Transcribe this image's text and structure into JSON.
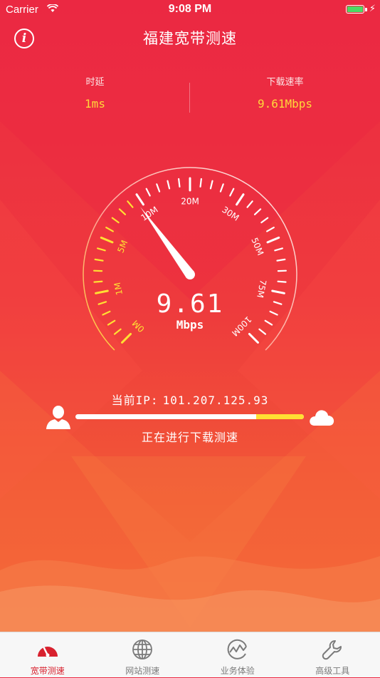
{
  "status_bar": {
    "carrier": "Carrier",
    "time": "9:08 PM"
  },
  "nav": {
    "title": "福建宽带测速"
  },
  "stats": {
    "latency": {
      "label": "时延",
      "value": "1ms"
    },
    "download": {
      "label": "下载速率",
      "value": "9.61Mbps"
    }
  },
  "gauge": {
    "tick_labels": [
      "0M",
      "1M",
      "5M",
      "10M",
      "20M",
      "30M",
      "50M",
      "75M",
      "100M"
    ],
    "speed_value": "9.61",
    "speed_unit": "Mbps",
    "colors": {
      "accent": "#ffd83a",
      "low": "#ffe033",
      "ticks": "#ffffff"
    }
  },
  "test": {
    "ip_label": "当前IP:",
    "ip_value": "101.207.125.93",
    "progress_fraction": 0.79,
    "status": "正在进行下载测速"
  },
  "tabs": [
    {
      "label": "宽带测速",
      "icon": "speedometer-icon",
      "active": true
    },
    {
      "label": "网站测速",
      "icon": "globe-icon",
      "active": false
    },
    {
      "label": "业务体验",
      "icon": "activity-icon",
      "active": false
    },
    {
      "label": "高级工具",
      "icon": "wrench-icon",
      "active": false
    }
  ],
  "colors": {
    "brand": "#e8273f",
    "active_tab": "#d8212e",
    "tab_inactive": "#7b7b7b"
  }
}
